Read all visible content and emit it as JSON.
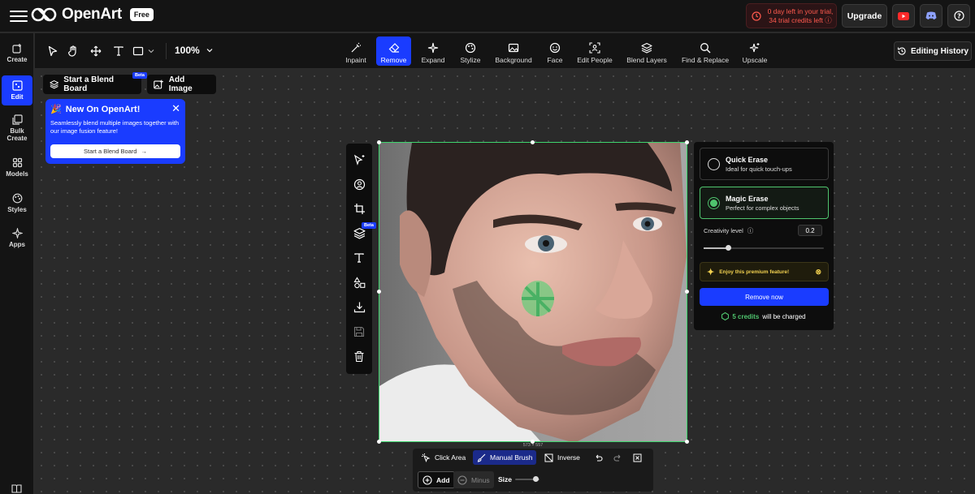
{
  "app": {
    "name": "OpenArt",
    "plan": "Free"
  },
  "trial": {
    "line1": "0 day left in your trial,",
    "line2": "34 trial credits left",
    "color": "#ff5a4e"
  },
  "header": {
    "upgrade_label": "Upgrade",
    "icons": [
      "youtube-icon",
      "discord-icon",
      "help-icon"
    ]
  },
  "sidebar": {
    "items": [
      {
        "label": "Create",
        "icon": "create-icon"
      },
      {
        "label": "Edit",
        "icon": "edit-icon",
        "active": true
      },
      {
        "label_line1": "Bulk",
        "label_line2": "Create",
        "icon": "bulk-create-icon"
      },
      {
        "label": "Models",
        "icon": "models-icon"
      },
      {
        "label": "Styles",
        "icon": "styles-icon"
      },
      {
        "label": "Apps",
        "icon": "apps-icon"
      }
    ]
  },
  "toolbar": {
    "zoom": "100%",
    "tools": [
      {
        "label": "Inpaint"
      },
      {
        "label": "Remove",
        "active": true
      },
      {
        "label": "Expand"
      },
      {
        "label": "Stylize"
      },
      {
        "label": "Background"
      },
      {
        "label": "Face"
      },
      {
        "label": "Edit People"
      },
      {
        "label": "Blend Layers"
      },
      {
        "label": "Find & Replace"
      },
      {
        "label": "Upscale"
      }
    ],
    "history_label": "Editing History"
  },
  "canvas": {
    "blend_board_label": "Start a Blend Board",
    "beta_label": "Beta",
    "add_image_label": "Add Image",
    "promo": {
      "title": "New On OpenArt!",
      "description": "Seamlessly blend multiple images together with our image fusion feature!",
      "button_label": "Start a Blend Board"
    },
    "image_dims": "573 × 557"
  },
  "erase_panel": {
    "quick": {
      "title": "Quick Erase",
      "subtitle": "Ideal for quick touch-ups"
    },
    "magic": {
      "title": "Magic Erase",
      "subtitle": "Perfect for complex objects"
    },
    "creativity_label": "Creativity level",
    "creativity_value": "0.2",
    "premium_text": "Enjoy this premium feature!",
    "remove_label": "Remove now",
    "credits_amount": "5 credits",
    "credits_suffix": "will be charged",
    "accent": "#4fc46e"
  },
  "brush_bar": {
    "click_area_label": "Click Area",
    "manual_brush_label": "Manual Brush",
    "inverse_label": "Inverse",
    "add_label": "Add",
    "minus_label": "Minus",
    "size_label": "Size"
  }
}
